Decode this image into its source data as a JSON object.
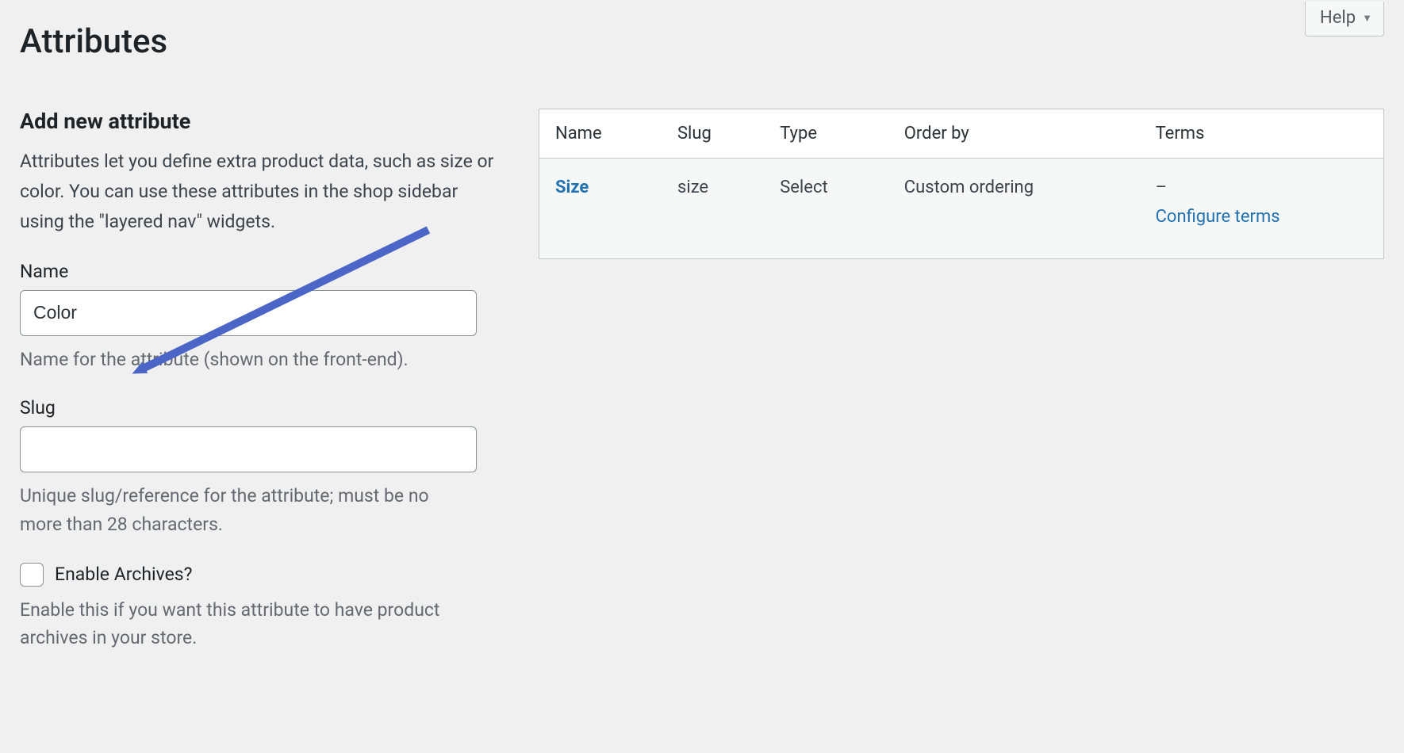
{
  "help_label": "Help",
  "page_title": "Attributes",
  "form": {
    "heading": "Add new attribute",
    "intro": "Attributes let you define extra product data, such as size or color. You can use these attributes in the shop sidebar using the \"layered nav\" widgets.",
    "name": {
      "label": "Name",
      "value": "Color",
      "hint": "Name for the attribute (shown on the front-end)."
    },
    "slug": {
      "label": "Slug",
      "value": "",
      "hint": "Unique slug/reference for the attribute; must be no more than 28 characters."
    },
    "archives": {
      "label": "Enable Archives?",
      "checked": false,
      "hint": "Enable this if you want this attribute to have product archives in your store."
    }
  },
  "table": {
    "headers": {
      "name": "Name",
      "slug": "Slug",
      "type": "Type",
      "order_by": "Order by",
      "terms": "Terms"
    },
    "rows": [
      {
        "name": "Size",
        "slug": "size",
        "type": "Select",
        "order_by": "Custom ordering",
        "terms_dash": "–",
        "configure": "Configure terms"
      }
    ]
  },
  "annotation_arrow_color": "#4b66c7"
}
